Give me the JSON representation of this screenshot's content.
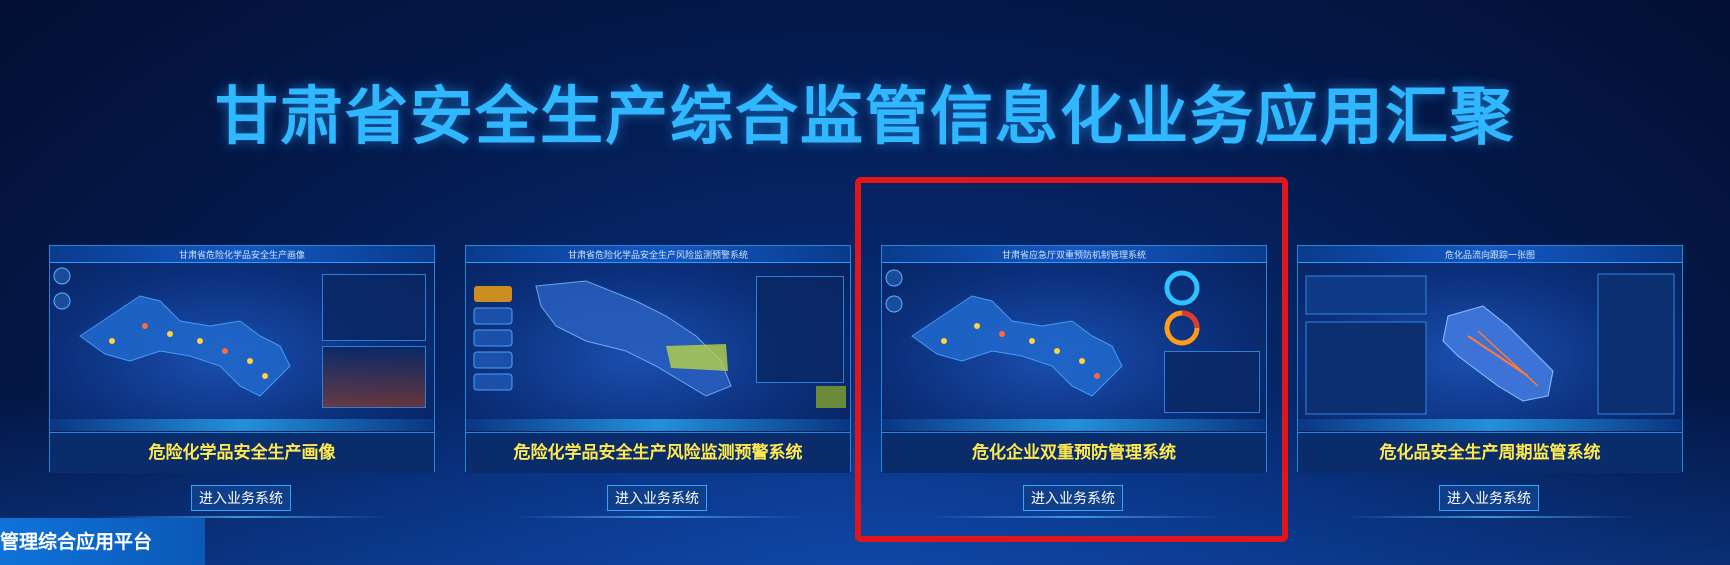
{
  "page": {
    "title": "甘肃省安全生产综合监管信息化业务应用汇聚",
    "bottom_tab": "管理综合应用平台"
  },
  "cards": [
    {
      "thumb_title": "甘肃省危险化学品安全生产画像",
      "label": "危险化学品安全生产画像",
      "button": "进入业务系统"
    },
    {
      "thumb_title": "甘肃省危险化学品安全生产风险监测预警系统",
      "label": "危险化学品安全生产风险监测预警系统",
      "button": "进入业务系统"
    },
    {
      "thumb_title": "甘肃省应急厅双重预防机制管理系统",
      "label": "危化企业双重预防管理系统",
      "button": "进入业务系统"
    },
    {
      "thumb_title": "危化品流向跟踪一张图",
      "label": "危化品安全生产周期监管系统",
      "button": "进入业务系统"
    }
  ],
  "colors": {
    "title": "#2fb8ff",
    "card_label": "#ffe94d",
    "highlight": "#e0161c",
    "accent": "#2a87d6"
  }
}
